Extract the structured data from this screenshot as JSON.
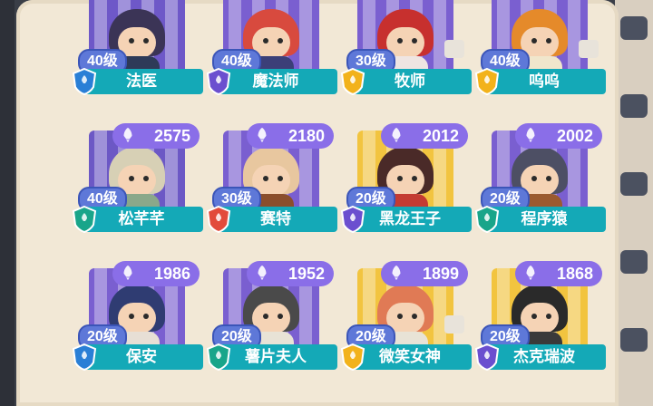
{
  "cards": [
    {
      "level": "40级",
      "name": "法医",
      "score": "",
      "badge_color": "#2a7fd6",
      "theme": {
        "bg": "#6e58c8",
        "hair": "#3b3456",
        "body": "#2e3a58"
      },
      "shirt": false
    },
    {
      "level": "40级",
      "name": "魔法师",
      "score": "",
      "badge_color": "#6b4fcf",
      "theme": {
        "bg": "#7a5fd0",
        "hair": "#d84a3e",
        "body": "#3c3f78"
      },
      "shirt": false
    },
    {
      "level": "30级",
      "name": "牧师",
      "score": "",
      "badge_color": "#f2b21b",
      "theme": {
        "bg": "#7a5fd0",
        "hair": "#c7302e",
        "body": "#efe5e2"
      },
      "shirt": true
    },
    {
      "level": "40级",
      "name": "呜呜",
      "score": "",
      "badge_color": "#f2b21b",
      "theme": {
        "bg": "#7a5fd0",
        "hair": "#e58a2a",
        "body": "#f0e6cc"
      },
      "shirt": true
    },
    {
      "level": "40级",
      "name": "松芊芊",
      "score": "2575",
      "badge_color": "#19a58a",
      "theme": {
        "bg": "#6c58c5",
        "hair": "#d7d0b5",
        "body": "#8aa88a"
      },
      "shirt": false
    },
    {
      "level": "30级",
      "name": "赛特",
      "score": "2180",
      "badge_color": "#e24b3b",
      "theme": {
        "bg": "#7a5fd0",
        "hair": "#e8c79f",
        "body": "#8b4e2c"
      },
      "shirt": false
    },
    {
      "level": "20级",
      "name": "黑龙王子",
      "score": "2012",
      "badge_color": "#6b4fcf",
      "theme": {
        "bg": "#f2c43f",
        "hair": "#4a2a28",
        "body": "#c43b32"
      },
      "shirt": false
    },
    {
      "level": "20级",
      "name": "程序猿",
      "score": "2002",
      "badge_color": "#19a58a",
      "theme": {
        "bg": "#7a5fd0",
        "hair": "#4d4f64",
        "body": "#9b5a2f"
      },
      "shirt": false
    },
    {
      "level": "20级",
      "name": "保安",
      "score": "1986",
      "badge_color": "#2a7fd6",
      "theme": {
        "bg": "#7a5fd0",
        "hair": "#2f3c72",
        "body": "#e7dfd5"
      },
      "shirt": false
    },
    {
      "level": "20级",
      "name": "薯片夫人",
      "score": "1952",
      "badge_color": "#19a58a",
      "theme": {
        "bg": "#7a5fd0",
        "hair": "#4a4a4a",
        "body": "#e8e3d6"
      },
      "shirt": false
    },
    {
      "level": "20级",
      "name": "微笑女神",
      "score": "1899",
      "badge_color": "#f2b21b",
      "theme": {
        "bg": "#f2c43f",
        "hair": "#e07a55",
        "body": "#e8e3d6"
      },
      "shirt": true
    },
    {
      "level": "20级",
      "name": "杰克瑞波",
      "score": "1868",
      "badge_color": "#6b4fcf",
      "theme": {
        "bg": "#f2c43f",
        "hair": "#2a2a2a",
        "body": "#3a3a3a"
      },
      "shirt": false
    }
  ],
  "colors": {
    "score_pill": "#8a6ee8",
    "name_bar": "#14a9b7",
    "level_pill": "#5e78d8"
  },
  "icons": {
    "score": "rocket-icon",
    "badge": "shield-icon",
    "shirt": "shirt-icon"
  }
}
